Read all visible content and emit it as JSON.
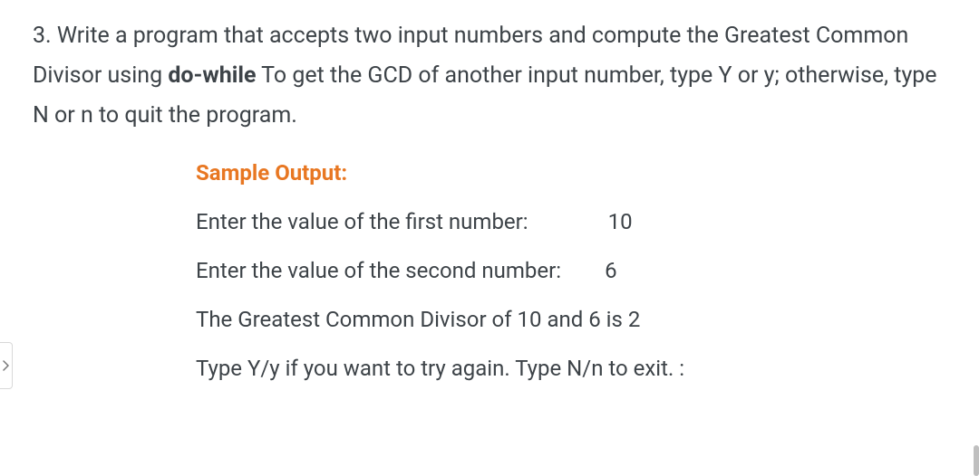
{
  "question": {
    "prefix": "3. Write a program that accepts two input numbers and compute the Greatest Common Divisor using ",
    "bold": "do-while",
    "suffix": " To get the GCD of another input number, type Y or y; otherwise, type N or n to quit the program."
  },
  "sample": {
    "heading": "Sample Output:",
    "prompt1": "Enter the value of the first number:",
    "value1": "10",
    "prompt2": "Enter the value of the second number:",
    "value2": "6",
    "result": "The Greatest Common Divisor of 10 and 6 is 2",
    "retry": "Type Y/y if you want to try again. Type N/n to exit. :"
  }
}
